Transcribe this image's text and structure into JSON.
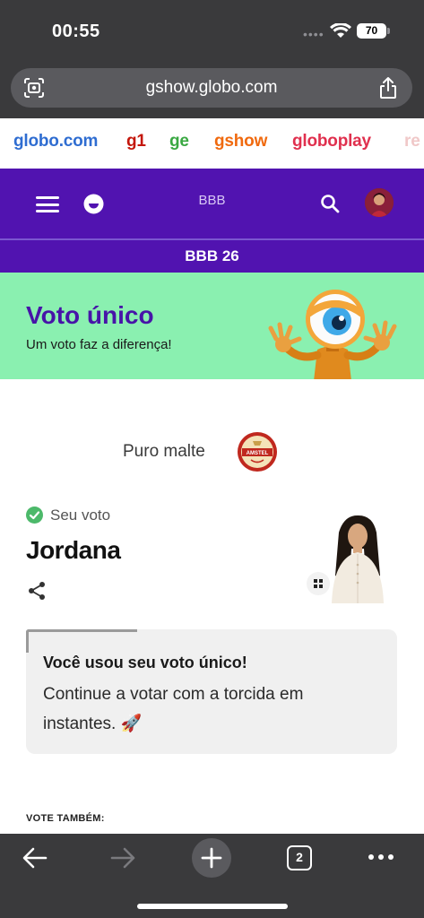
{
  "status_bar": {
    "time": "00:55",
    "battery": "70"
  },
  "browser": {
    "url": "gshow.globo.com",
    "tab_count": "2"
  },
  "globo_nav": {
    "items": [
      {
        "label": "globo.com",
        "color": "#2f6dd1"
      },
      {
        "label": "g1",
        "color": "#c4170c"
      },
      {
        "label": "ge",
        "color": "#3aa842"
      },
      {
        "label": "gshow",
        "color": "#f06a0f"
      },
      {
        "label": "globoplay",
        "color": "#e0304e"
      },
      {
        "label": "re",
        "color": "#f0c8c8"
      }
    ]
  },
  "header": {
    "title": "BBB",
    "section": "BBB 26",
    "brand_color": "#5113b0"
  },
  "banner": {
    "title": "Voto único",
    "subtitle": "Um voto faz a diferença!",
    "bg_color": "#8af0b0"
  },
  "sponsor": {
    "label": "Puro malte",
    "logo_text": "AMSTEL"
  },
  "vote": {
    "status_label": "Seu voto",
    "candidate": "Jordana"
  },
  "message": {
    "title": "Você usou seu voto único!",
    "body": "Continue a votar com a torcida em instantes. 🚀"
  },
  "vote_also": "VOTE TAMBÉM:"
}
